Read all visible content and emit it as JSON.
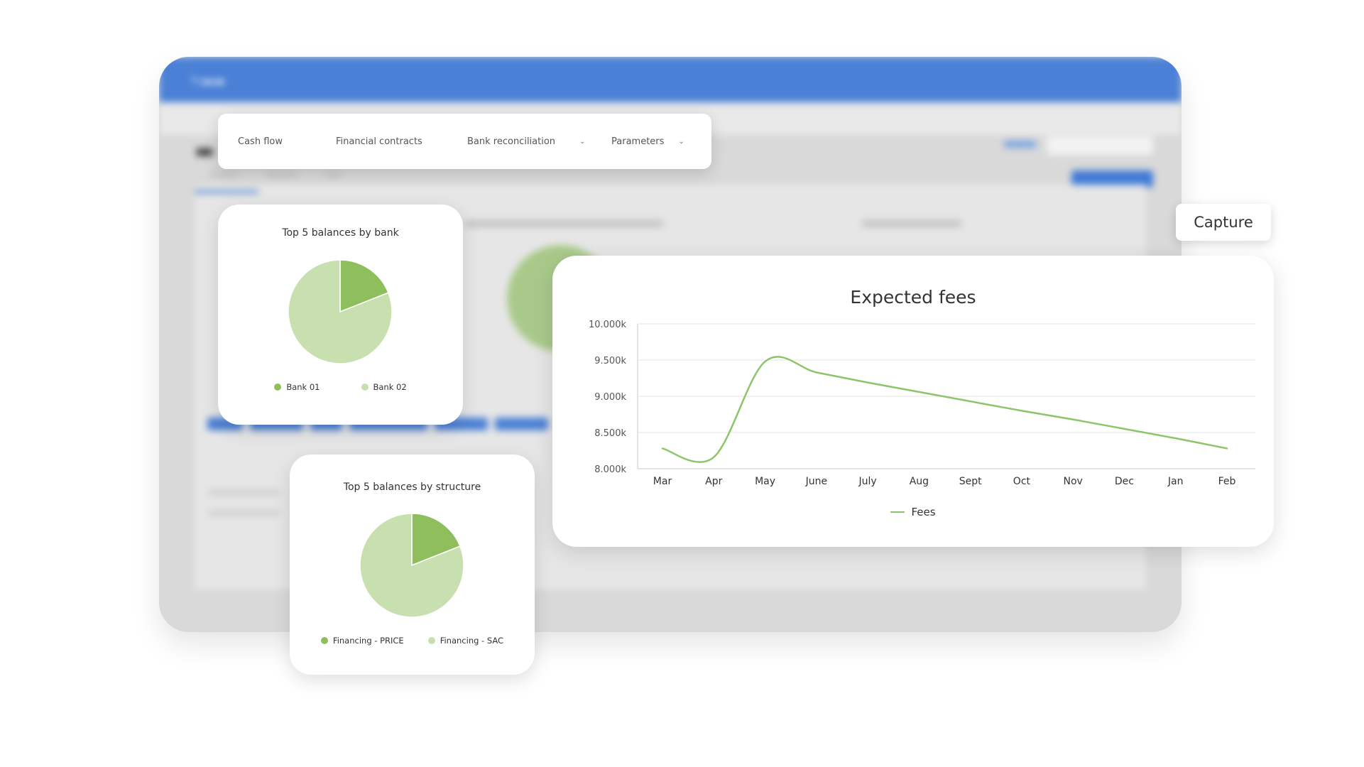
{
  "colors": {
    "header_blue": "#4a80d6",
    "pie_dark_green": "#8fbf5d",
    "pie_light_green": "#c8e0b0",
    "line_green": "#8cc56a"
  },
  "nav": {
    "items": [
      {
        "label": "Cash flow",
        "has_dropdown": false
      },
      {
        "label": "Financial contracts",
        "has_dropdown": false
      },
      {
        "label": "Bank reconciliation",
        "has_dropdown": true
      },
      {
        "label": "Parameters",
        "has_dropdown": true
      }
    ],
    "dropdown_icon": "chevron-down-icon"
  },
  "capture": {
    "label": "Capture"
  },
  "bank_chart": {
    "chart_data": {
      "type": "pie",
      "title": "Top 5 balances by bank",
      "series": [
        {
          "name": "Bank 01",
          "value": 19,
          "color": "#8fbf5d"
        },
        {
          "name": "Bank 02",
          "value": 81,
          "color": "#c8e0b0"
        }
      ],
      "legend": "bottom"
    }
  },
  "structure_chart": {
    "chart_data": {
      "type": "pie",
      "title": "Top 5 balances by structure",
      "series": [
        {
          "name": "Financing - PRICE",
          "value": 19,
          "color": "#8fbf5d"
        },
        {
          "name": "Financing - SAC",
          "value": 81,
          "color": "#c8e0b0"
        }
      ],
      "legend": "bottom"
    }
  },
  "fees_chart": {
    "chart_data": {
      "type": "line",
      "title": "Expected fees",
      "categories": [
        "Mar",
        "Apr",
        "May",
        "June",
        "July",
        "Aug",
        "Sept",
        "Oct",
        "Nov",
        "Dec",
        "Jan",
        "Feb"
      ],
      "series": [
        {
          "name": "Fees",
          "color": "#8cc56a",
          "values": [
            8280,
            8160,
            9480,
            9330,
            9190,
            9060,
            8930,
            8800,
            8680,
            8550,
            8420,
            8280
          ]
        }
      ],
      "yticks": [
        8000,
        8500,
        9000,
        9500,
        10000
      ],
      "ytick_labels": [
        "8.000k",
        "8.500k",
        "9.000k",
        "9.500k",
        "10.000k"
      ],
      "ylim": [
        8000,
        10000
      ],
      "grid": true,
      "legend": "bottom"
    }
  }
}
